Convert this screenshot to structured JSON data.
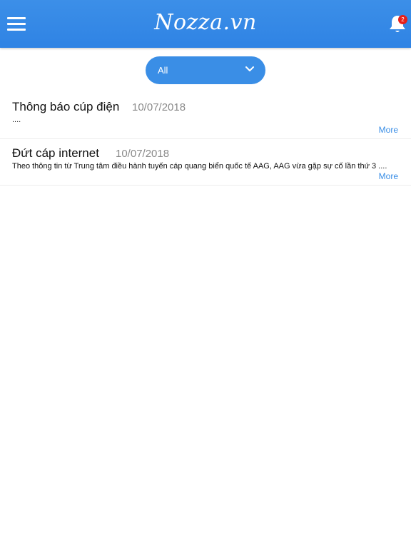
{
  "header": {
    "brand": "Nozza.vn",
    "menu_icon": "hamburger-menu-icon",
    "bell_icon": "bell-icon",
    "notification_count": "2"
  },
  "filter": {
    "selected": "All",
    "chevron_icon": "chevron-down-icon"
  },
  "notifications": [
    {
      "title": "Thông báo cúp điện",
      "date": "10/07/2018",
      "excerpt": "....",
      "more_label": "More"
    },
    {
      "title": "Đứt cáp internet",
      "date": "10/07/2018",
      "excerpt": "Theo thông tin từ Trung tâm điều hành tuyến cáp quang biển quốc tế AAG, AAG vừa gặp sự cố lần thứ 3 ....",
      "more_label": "More"
    }
  ],
  "colors": {
    "accent": "#3a8ee6",
    "header": "#2f83e4",
    "badge": "#e8201a",
    "date_text": "#8a8a8a"
  }
}
